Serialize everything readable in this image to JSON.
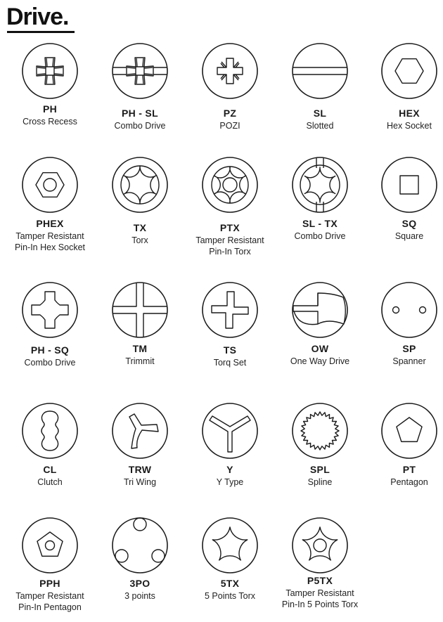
{
  "title": "Drive.",
  "drives": [
    {
      "id": "ph",
      "code": "PH",
      "desc": [
        "Cross Recess"
      ],
      "icon": "phillips-cross-icon"
    },
    {
      "id": "phsl",
      "code": "PH - SL",
      "desc": [
        "Combo Drive"
      ],
      "icon": "phillips-slot-combo-icon"
    },
    {
      "id": "pz",
      "code": "PZ",
      "desc": [
        "POZI"
      ],
      "icon": "pozidriv-icon"
    },
    {
      "id": "sl",
      "code": "SL",
      "desc": [
        "Slotted"
      ],
      "icon": "slotted-icon"
    },
    {
      "id": "hex",
      "code": "HEX",
      "desc": [
        "Hex Socket"
      ],
      "icon": "hex-socket-icon"
    },
    {
      "id": "phex",
      "code": "PHEX",
      "desc": [
        "Tamper Resistant",
        "Pin-In Hex Socket"
      ],
      "icon": "pin-hex-icon"
    },
    {
      "id": "tx",
      "code": "TX",
      "desc": [
        "Torx"
      ],
      "icon": "torx-icon"
    },
    {
      "id": "ptx",
      "code": "PTX",
      "desc": [
        "Tamper Resistant",
        "Pin-In Torx"
      ],
      "icon": "pin-torx-icon"
    },
    {
      "id": "sltx",
      "code": "SL - TX",
      "desc": [
        "Combo Drive"
      ],
      "icon": "slot-torx-combo-icon"
    },
    {
      "id": "sq",
      "code": "SQ",
      "desc": [
        "Square"
      ],
      "icon": "square-icon"
    },
    {
      "id": "phsq",
      "code": "PH - SQ",
      "desc": [
        "Combo Drive"
      ],
      "icon": "phillips-square-combo-icon"
    },
    {
      "id": "tm",
      "code": "TM",
      "desc": [
        "Trimmit"
      ],
      "icon": "trimmit-icon"
    },
    {
      "id": "ts",
      "code": "TS",
      "desc": [
        "Torq Set"
      ],
      "icon": "torq-set-icon"
    },
    {
      "id": "ow",
      "code": "OW",
      "desc": [
        "One Way Drive"
      ],
      "icon": "one-way-icon"
    },
    {
      "id": "sp",
      "code": "SP",
      "desc": [
        "Spanner"
      ],
      "icon": "spanner-icon"
    },
    {
      "id": "cl",
      "code": "CL",
      "desc": [
        "Clutch"
      ],
      "icon": "clutch-icon"
    },
    {
      "id": "trw",
      "code": "TRW",
      "desc": [
        "Tri Wing"
      ],
      "icon": "tri-wing-icon"
    },
    {
      "id": "y",
      "code": "Y",
      "desc": [
        "Y Type"
      ],
      "icon": "y-type-icon"
    },
    {
      "id": "spl",
      "code": "SPL",
      "desc": [
        "Spline"
      ],
      "icon": "spline-icon"
    },
    {
      "id": "pt",
      "code": "PT",
      "desc": [
        "Pentagon"
      ],
      "icon": "pentagon-icon"
    },
    {
      "id": "pph",
      "code": "PPH",
      "desc": [
        "Tamper Resistant",
        "Pin-In Pentagon"
      ],
      "icon": "pin-pentagon-icon"
    },
    {
      "id": "3po",
      "code": "3PO",
      "desc": [
        "3 points"
      ],
      "icon": "three-points-icon"
    },
    {
      "id": "5tx",
      "code": "5TX",
      "desc": [
        "5 Points Torx"
      ],
      "icon": "five-point-torx-icon"
    },
    {
      "id": "p5tx",
      "code": "P5TX",
      "desc": [
        "Tamper Resistant",
        "Pin-In 5 Points Torx"
      ],
      "icon": "pin-five-point-torx-icon"
    }
  ]
}
